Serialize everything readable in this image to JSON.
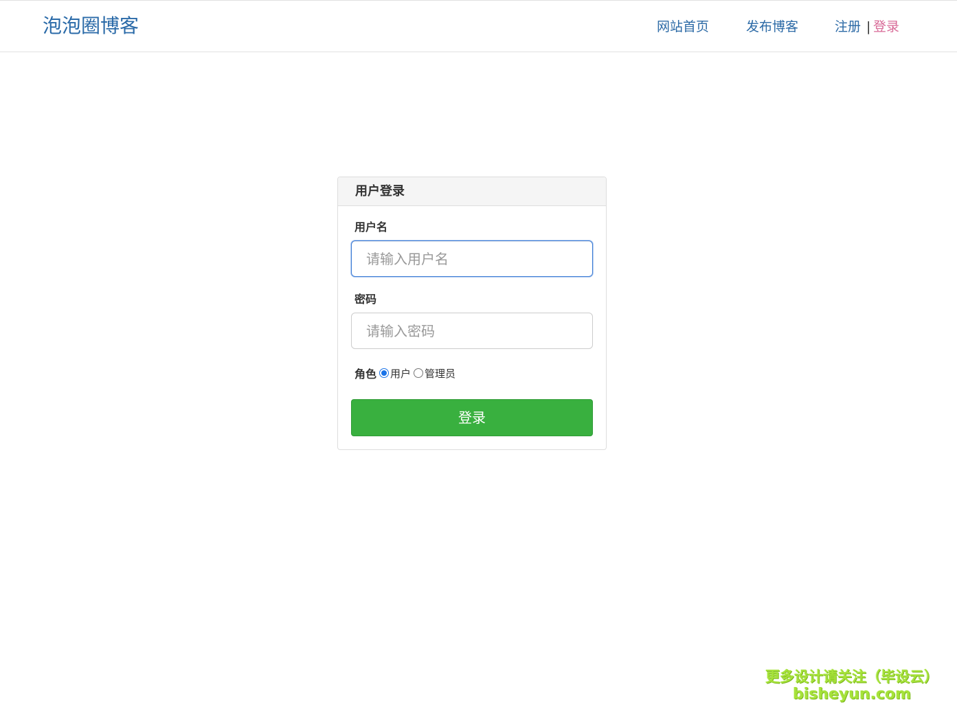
{
  "navbar": {
    "brand": "泡泡圈博客",
    "links": {
      "home": "网站首页",
      "post": "发布博客",
      "register": "注册",
      "separator": "|",
      "login": "登录"
    }
  },
  "login_panel": {
    "title": "用户登录",
    "username": {
      "label": "用户名",
      "placeholder": "请输入用户名",
      "value": ""
    },
    "password": {
      "label": "密码",
      "placeholder": "请输入密码",
      "value": ""
    },
    "role": {
      "label": "角色",
      "options": [
        "用户",
        "管理员"
      ],
      "selected": "用户"
    },
    "submit_label": "登录"
  },
  "watermark": {
    "line1": "更多设计请关注（毕设云）",
    "line2": "bisheyun.com"
  },
  "colors": {
    "brand": "#2a6aa8",
    "nav_link": "#2c6aa6",
    "active_login": "#d86a97",
    "submit_button": "#39b03f",
    "watermark": "#a6e23a"
  }
}
